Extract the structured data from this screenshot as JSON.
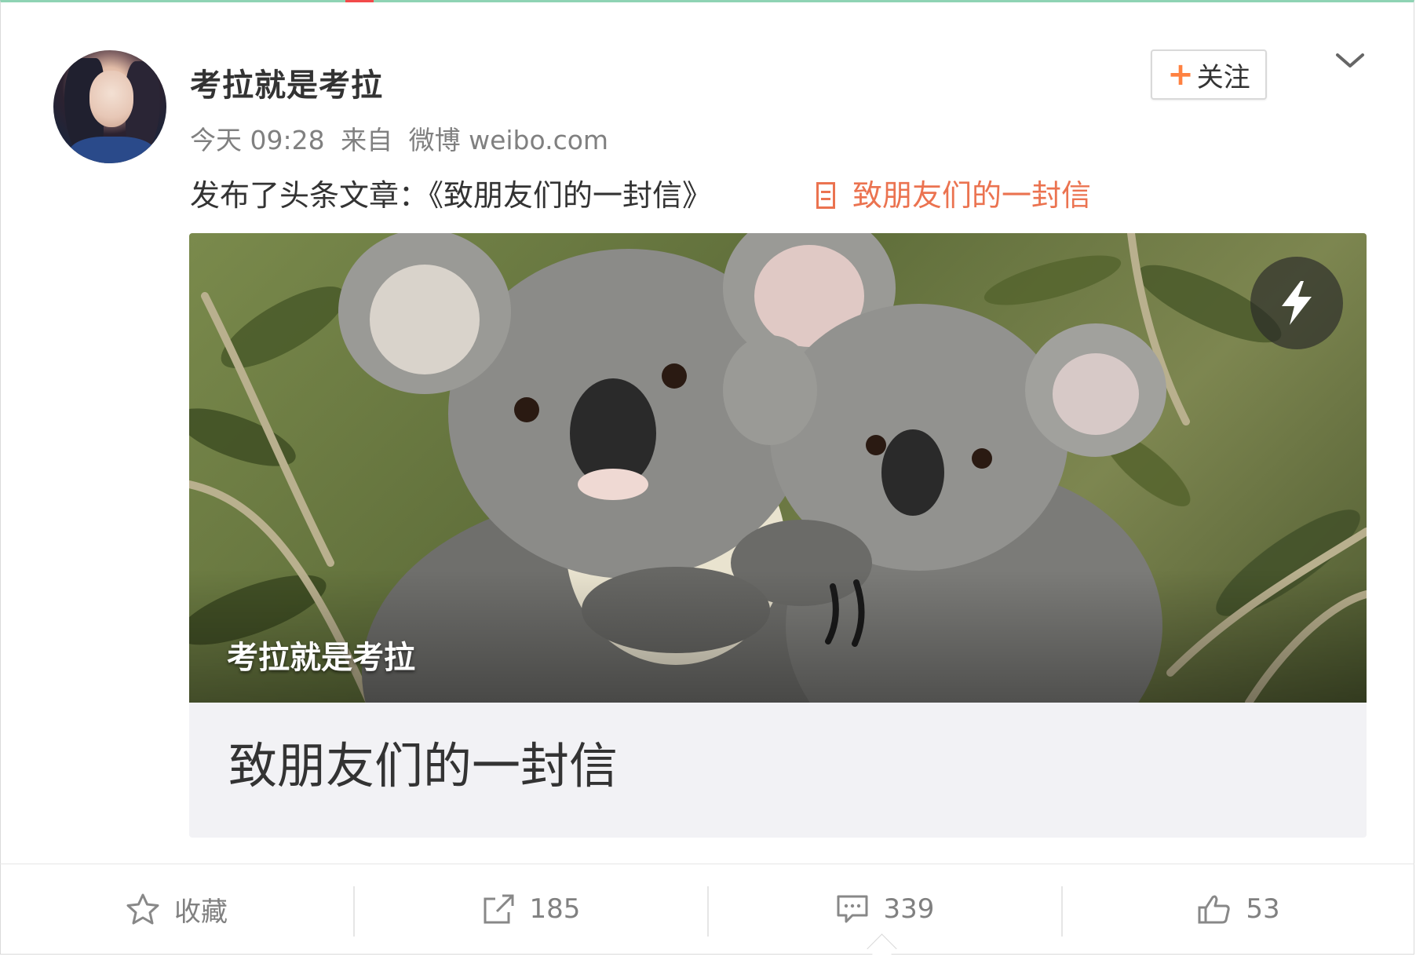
{
  "post": {
    "user_name": "考拉就是考拉",
    "time": "今天 09:28",
    "source_prefix": "来自",
    "source": "微博 weibo.com",
    "content_text": "发布了头条文章：《致朋友们的一封信》",
    "article_link_label": "致朋友们的一封信",
    "follow_label": "关注",
    "follow_plus": "+"
  },
  "card": {
    "caption": "考拉就是考拉",
    "title": "致朋友们的一封信"
  },
  "actions": {
    "favorite_label": "收藏",
    "repost_count": "185",
    "comment_count": "339",
    "like_count": "53"
  },
  "colors": {
    "link_orange": "#eb7350",
    "follow_plus_orange": "#ff8140",
    "meta_gray": "#808080",
    "card_bg": "#f2f2f5",
    "frame_top_green": "#8fd3b4"
  },
  "icons": [
    "chevron-down-icon",
    "document-icon",
    "lightning-icon",
    "star-icon",
    "share-icon",
    "comment-icon",
    "thumbs-up-icon"
  ]
}
